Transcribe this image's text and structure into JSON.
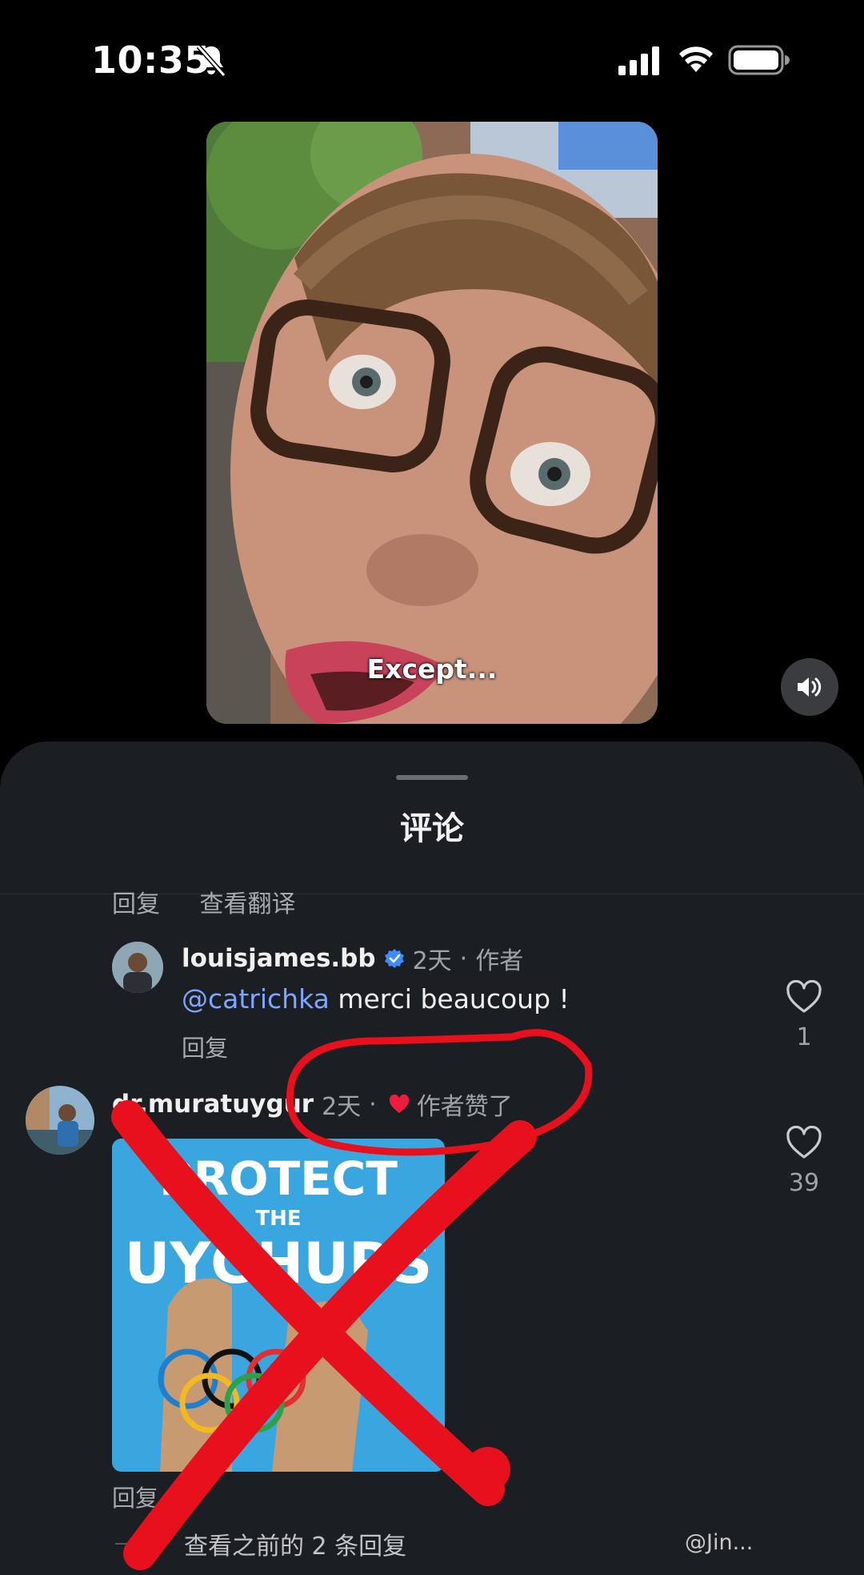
{
  "status_bar": {
    "time": "10:35",
    "icons": [
      "bell-slash-icon",
      "signal-icon",
      "wifi-icon",
      "battery-icon"
    ]
  },
  "video": {
    "caption": "Except...",
    "mute_icon": "speaker-icon"
  },
  "comments": {
    "title": "评论",
    "cut_row": {
      "reply": "回复",
      "translate": "查看翻译"
    },
    "items": [
      {
        "username": "louisjames.bb",
        "verified": true,
        "time": "2天",
        "tag": "作者",
        "mention": "@catrichka",
        "text": " merci beaucoup !",
        "reply": "回复",
        "likes": "1"
      },
      {
        "username": "dr.muratuygur",
        "time": "2天",
        "tag": "作者赞了",
        "sticker": {
          "line1": "PROTECT",
          "line2": "THE",
          "line3": "UYGHURS"
        },
        "reply": "回复",
        "likes": "39"
      }
    ],
    "more_replies": "查看之前的 2 条回复",
    "watermark": "@Jin..."
  },
  "colors": {
    "background": "#000000",
    "sheet": "#1b1e22",
    "mention": "#7fa6ff",
    "verified": "#3d8bff",
    "heart": "#ee1d3d",
    "annotation": "#e8101c"
  }
}
